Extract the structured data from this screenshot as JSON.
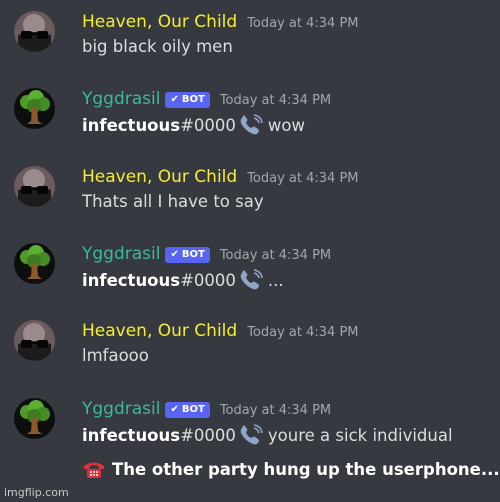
{
  "colors": {
    "background": "#36393f",
    "human_name": "#f4ee2e",
    "bot_name": "#3cb99c",
    "bot_badge": "#5865f2",
    "timestamp": "#a3a6aa"
  },
  "messages": [
    {
      "author": "Heaven, Our Child",
      "bot": false,
      "timestamp": "Today at 4:34 PM",
      "text": "big black oily men"
    },
    {
      "author": "Yggdrasil",
      "bot": true,
      "badge": "BOT",
      "timestamp": "Today at 4:34 PM",
      "user": "infectuous",
      "discriminator": "#0000",
      "icon": "phone-icon",
      "text": "wow"
    },
    {
      "author": "Heaven, Our Child",
      "bot": false,
      "timestamp": "Today at 4:34 PM",
      "text": "Thats all I have to say"
    },
    {
      "author": "Yggdrasil",
      "bot": true,
      "badge": "BOT",
      "timestamp": "Today at 4:34 PM",
      "user": "infectuous",
      "discriminator": "#0000",
      "icon": "phone-icon",
      "text": "..."
    },
    {
      "author": "Heaven, Our Child",
      "bot": false,
      "timestamp": "Today at 4:34 PM",
      "text": "lmfaooo"
    },
    {
      "author": "Yggdrasil",
      "bot": true,
      "badge": "BOT",
      "timestamp": "Today at 4:34 PM",
      "user": "infectuous",
      "discriminator": "#0000",
      "icon": "phone-icon",
      "text": "youre a sick individual"
    }
  ],
  "hangup": {
    "icon": "telephone-hangup-icon",
    "text": "The other party hung up the userphone..."
  },
  "watermark": "imgflip.com"
}
